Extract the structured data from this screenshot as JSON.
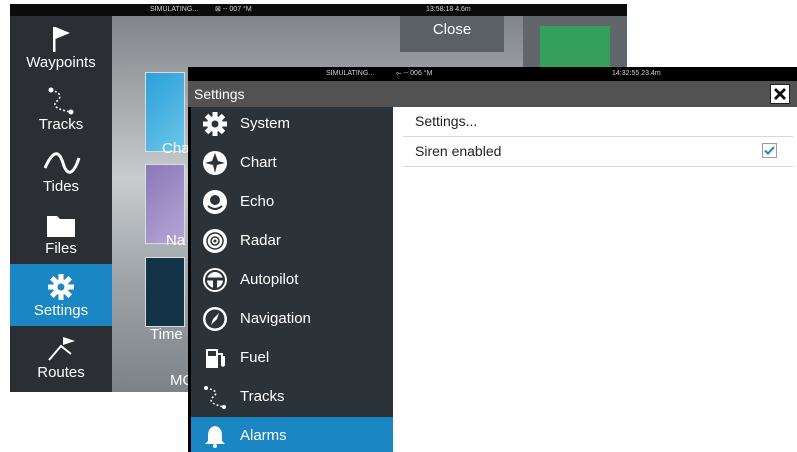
{
  "background_window": {
    "status": {
      "mode": "SIMULATING...",
      "gps": "⊠ -- 007 °M",
      "time": "13:58:18  4.6m"
    },
    "sidebar": [
      {
        "label": "Waypoints",
        "icon": "flag-icon"
      },
      {
        "label": "Tracks",
        "icon": "track-icon"
      },
      {
        "label": "Tides",
        "icon": "tide-wave-icon"
      },
      {
        "label": "Files",
        "icon": "folder-icon"
      },
      {
        "label": "Settings",
        "icon": "gear-icon",
        "active": true
      },
      {
        "label": "Routes",
        "icon": "route-icon"
      }
    ],
    "close_label": "Close",
    "tiles": {
      "chart": "Cha",
      "nav": "Na",
      "time": "Time",
      "more": "MO"
    }
  },
  "settings_window": {
    "status": {
      "mode": "SIMULATING...",
      "gps": "⟜ -- 006 °M",
      "time": "14:32:55  23.4m"
    },
    "title": "Settings",
    "menu": [
      {
        "label": "System",
        "icon": "gear-icon"
      },
      {
        "label": "Chart",
        "icon": "chart-icon"
      },
      {
        "label": "Echo",
        "icon": "echo-icon"
      },
      {
        "label": "Radar",
        "icon": "radar-icon"
      },
      {
        "label": "Autopilot",
        "icon": "steering-wheel-icon"
      },
      {
        "label": "Navigation",
        "icon": "compass-icon"
      },
      {
        "label": "Fuel",
        "icon": "fuel-pump-icon"
      },
      {
        "label": "Tracks",
        "icon": "track-icon"
      },
      {
        "label": "Alarms",
        "icon": "bell-icon",
        "active": true
      }
    ],
    "panel": {
      "settings_link": "Settings...",
      "siren_label": "Siren enabled",
      "siren_enabled": true
    }
  },
  "colors": {
    "accent": "#1b86c4",
    "menu_bg": "#2c3338",
    "titlebar": "#525252"
  }
}
